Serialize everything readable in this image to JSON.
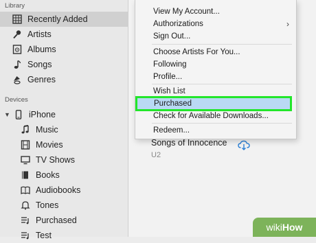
{
  "sidebar": {
    "library_header": "Library",
    "library": [
      {
        "label": "Recently Added",
        "icon": "grid-icon",
        "selected": true
      },
      {
        "label": "Artists",
        "icon": "microphone-icon"
      },
      {
        "label": "Albums",
        "icon": "album-icon"
      },
      {
        "label": "Songs",
        "icon": "music-note-icon"
      },
      {
        "label": "Genres",
        "icon": "genres-icon"
      }
    ],
    "devices_header": "Devices",
    "device": {
      "label": "iPhone",
      "icon": "phone-icon",
      "disclosure": "▼"
    },
    "device_items": [
      {
        "label": "Music",
        "icon": "music-note-icon"
      },
      {
        "label": "Movies",
        "icon": "film-icon"
      },
      {
        "label": "TV Shows",
        "icon": "tv-icon"
      },
      {
        "label": "Books",
        "icon": "book-icon"
      },
      {
        "label": "Audiobooks",
        "icon": "audiobook-icon"
      },
      {
        "label": "Tones",
        "icon": "bell-icon"
      },
      {
        "label": "Purchased",
        "icon": "list-icon"
      },
      {
        "label": "Test",
        "icon": "list-icon"
      }
    ]
  },
  "menu": {
    "items": [
      {
        "label": "View My Account..."
      },
      {
        "label": "Authorizations",
        "submenu": "›"
      },
      {
        "label": "Sign Out..."
      },
      {
        "label": "Choose Artists For You..."
      },
      {
        "label": "Following"
      },
      {
        "label": "Profile..."
      },
      {
        "label": "Wish List"
      },
      {
        "label": "Purchased",
        "highlighted": true
      },
      {
        "label": "Check for Available Downloads..."
      },
      {
        "label": "Redeem..."
      }
    ]
  },
  "main": {
    "album_title": "Songs of Innocence",
    "album_artist": "U2"
  },
  "watermark": {
    "prefix": "wiki",
    "suffix": "How"
  },
  "colors": {
    "highlight_border": "#22e62a",
    "highlight_fill": "#b9d9f4",
    "cloud": "#2a7fd6"
  }
}
